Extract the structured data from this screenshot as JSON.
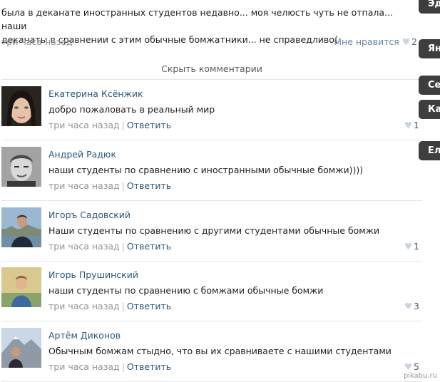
{
  "top_post": {
    "text_line1": "была в деканате иностранных студентов недавно... моя челюсть чуть не отпала... наши",
    "text_line2": "деканаты в сравнении с этим обычные бомжатники... не справедливо(",
    "time": "три часа назад",
    "like_label": "Мне нравится",
    "like_count": "2"
  },
  "hide_comments_label": "Скрыть комментарии",
  "comments": [
    {
      "author": "Екатерина Ксёнжик",
      "text": "добро пожаловать в реальный мир",
      "time": "три часа назад",
      "reply": "Ответить",
      "likes": "1"
    },
    {
      "author": "Андрей Радюк",
      "text": "наши студенты по сравнению с иностранными обычные бомжи))))",
      "time": "три часа назад",
      "reply": "Ответить",
      "likes": ""
    },
    {
      "author": "Игоръ Садовский",
      "text": "Наши студенты по сравнению с другими студентами обычные бомжи",
      "time": "три часа назад",
      "reply": "Ответить",
      "likes": "1"
    },
    {
      "author": "Игорь Прушинский",
      "text": "наши студенты по сравнению с бомжами обычные бомжи",
      "time": "три часа назад",
      "reply": "Ответить",
      "likes": "3"
    },
    {
      "author": "Артём Диконов",
      "text": "Обычным бомжам стыдно, что вы их сравниваете с нашими студентами",
      "time": "три часа назад",
      "reply": "Ответить",
      "likes": "5"
    }
  ],
  "side_buttons": [
    "Эд",
    "Ян",
    "Се",
    "Ка",
    "Ел"
  ],
  "watermark": "pikabu.ru",
  "colors": {
    "link": "#2b587a",
    "muted": "#939393",
    "divider": "#e3e6ea",
    "side_button": "#3e3e3e"
  }
}
